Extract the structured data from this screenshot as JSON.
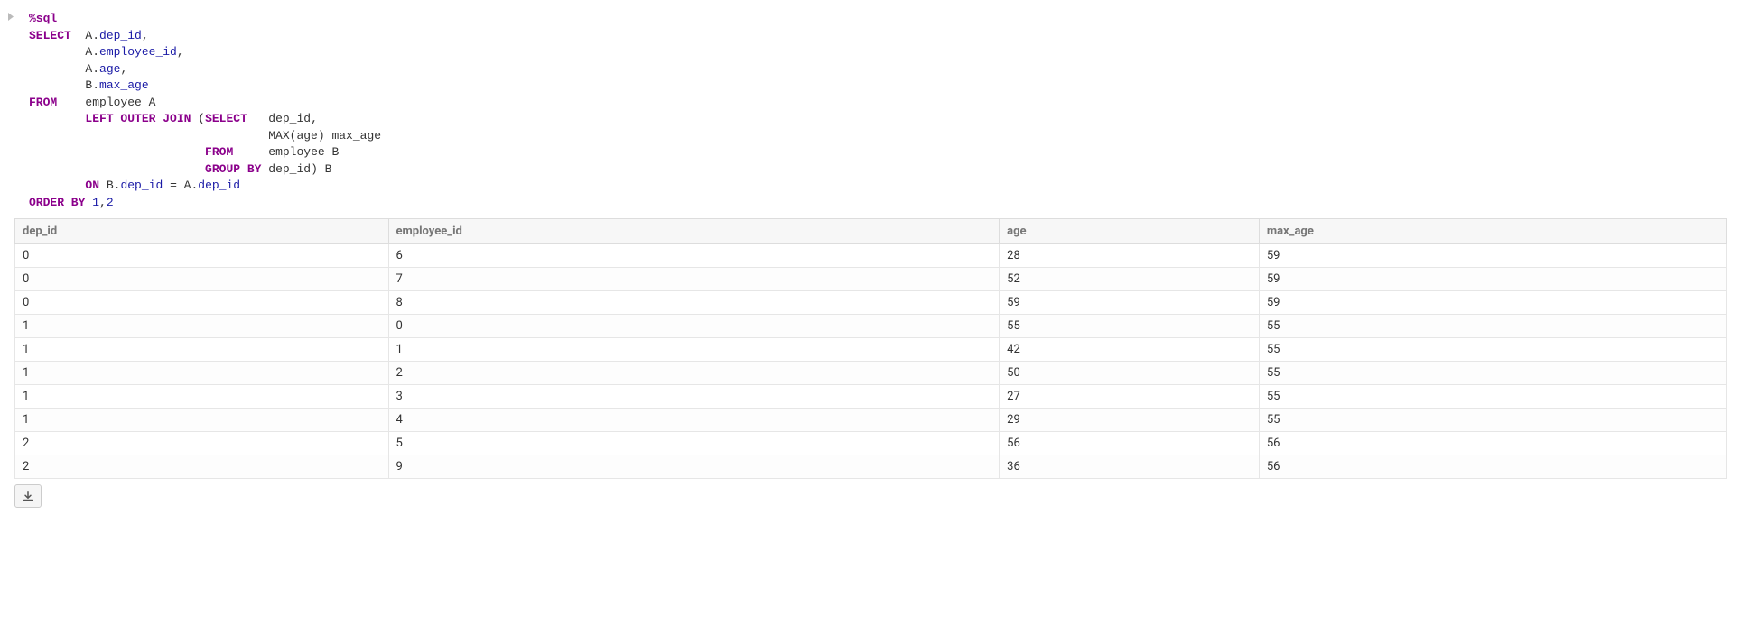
{
  "code": {
    "tokens": [
      [
        [
          "kw-magic",
          "%sql"
        ]
      ],
      [
        [
          "kw",
          "SELECT"
        ],
        [
          "plain",
          "  A"
        ],
        [
          "plain",
          "."
        ],
        [
          "ident",
          "dep_id"
        ],
        [
          "plain",
          ","
        ]
      ],
      [
        [
          "plain",
          "        A"
        ],
        [
          "plain",
          "."
        ],
        [
          "ident",
          "employee_id"
        ],
        [
          "plain",
          ","
        ]
      ],
      [
        [
          "plain",
          "        A"
        ],
        [
          "plain",
          "."
        ],
        [
          "ident",
          "age"
        ],
        [
          "plain",
          ","
        ]
      ],
      [
        [
          "plain",
          "        B"
        ],
        [
          "plain",
          "."
        ],
        [
          "ident",
          "max_age"
        ]
      ],
      [
        [
          "kw",
          "FROM"
        ],
        [
          "plain",
          "    employee A"
        ]
      ],
      [
        [
          "plain",
          "        "
        ],
        [
          "kw",
          "LEFT OUTER JOIN"
        ],
        [
          "plain",
          " ("
        ],
        [
          "kw",
          "SELECT"
        ],
        [
          "plain",
          "   dep_id,"
        ]
      ],
      [
        [
          "plain",
          "                                  MAX(age) max_age"
        ]
      ],
      [
        [
          "plain",
          "                         "
        ],
        [
          "kw",
          "FROM"
        ],
        [
          "plain",
          "     employee B"
        ]
      ],
      [
        [
          "plain",
          "                         "
        ],
        [
          "kw",
          "GROUP BY"
        ],
        [
          "plain",
          " dep_id) B"
        ]
      ],
      [
        [
          "plain",
          "        "
        ],
        [
          "kw",
          "ON"
        ],
        [
          "plain",
          " B"
        ],
        [
          "plain",
          "."
        ],
        [
          "ident",
          "dep_id"
        ],
        [
          "plain",
          " = A"
        ],
        [
          "plain",
          "."
        ],
        [
          "ident",
          "dep_id"
        ]
      ],
      [
        [
          "kw",
          "ORDER BY"
        ],
        [
          "plain",
          " "
        ],
        [
          "num",
          "1"
        ],
        [
          "plain",
          ","
        ],
        [
          "num",
          "2"
        ]
      ]
    ]
  },
  "table": {
    "columns": [
      "dep_id",
      "employee_id",
      "age",
      "max_age"
    ],
    "rows": [
      [
        "0",
        "6",
        "28",
        "59"
      ],
      [
        "0",
        "7",
        "52",
        "59"
      ],
      [
        "0",
        "8",
        "59",
        "59"
      ],
      [
        "1",
        "0",
        "55",
        "55"
      ],
      [
        "1",
        "1",
        "42",
        "55"
      ],
      [
        "1",
        "2",
        "50",
        "55"
      ],
      [
        "1",
        "3",
        "27",
        "55"
      ],
      [
        "1",
        "4",
        "29",
        "55"
      ],
      [
        "2",
        "5",
        "56",
        "56"
      ],
      [
        "2",
        "9",
        "36",
        "56"
      ]
    ]
  },
  "buttons": {
    "download_title": "Download"
  }
}
